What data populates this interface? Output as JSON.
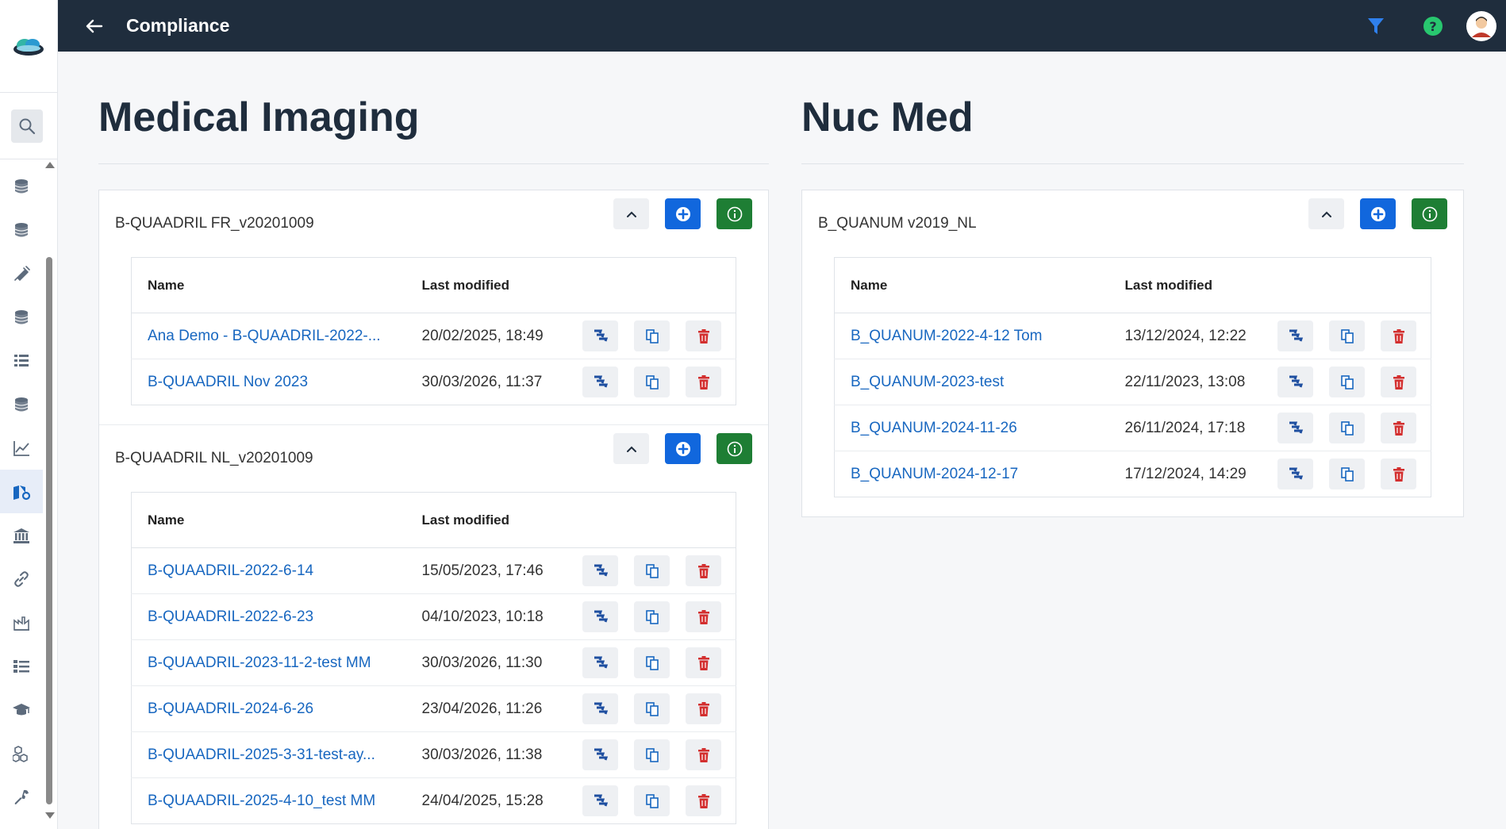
{
  "app": {
    "title": "Compliance"
  },
  "colors": {
    "topbar": "#1f2d3d",
    "link": "#1867c0",
    "add": "#1167dd",
    "info": "#1e7e34",
    "delete": "#d32f2f",
    "help": "#28c76f",
    "filter": "#2f80ed"
  },
  "sidebar": {
    "icons": [
      "database-icon",
      "database-icon",
      "syringe-icon",
      "database-icon",
      "list-icon",
      "database-icon",
      "chart-line-icon",
      "book-gear-icon",
      "bank-icon",
      "link-icon",
      "factory-chart-icon",
      "checklist-icon",
      "graduation-cap-icon",
      "cubes-icon",
      "wrench-icon"
    ],
    "active_index": 7
  },
  "columns": [
    {
      "title": "Medical Imaging",
      "sections": [
        {
          "title": "B-QUAADRIL FR_v20201009",
          "headers": {
            "name": "Name",
            "modified": "Last modified"
          },
          "rows": [
            {
              "name": "Ana Demo - B-QUAADRIL-2022-...",
              "modified": "20/02/2025, 18:49"
            },
            {
              "name": "B-QUAADRIL Nov 2023",
              "modified": "30/03/2026, 11:37"
            }
          ]
        },
        {
          "title": "B-QUAADRIL NL_v20201009",
          "headers": {
            "name": "Name",
            "modified": "Last modified"
          },
          "rows": [
            {
              "name": "B-QUAADRIL-2022-6-14",
              "modified": "15/05/2023, 17:46"
            },
            {
              "name": "B-QUAADRIL-2022-6-23",
              "modified": "04/10/2023, 10:18"
            },
            {
              "name": "B-QUAADRIL-2023-11-2-test MM",
              "modified": "30/03/2026, 11:30"
            },
            {
              "name": "B-QUAADRIL-2024-6-26",
              "modified": "23/04/2026, 11:26"
            },
            {
              "name": "B-QUAADRIL-2025-3-31-test-ay...",
              "modified": "30/03/2026, 11:38"
            },
            {
              "name": "B-QUAADRIL-2025-4-10_test MM",
              "modified": "24/04/2025, 15:28"
            }
          ]
        }
      ]
    },
    {
      "title": "Nuc Med",
      "sections": [
        {
          "title": "B_QUANUM v2019_NL",
          "headers": {
            "name": "Name",
            "modified": "Last modified"
          },
          "rows": [
            {
              "name": "B_QUANUM-2022-4-12 Tom",
              "modified": "13/12/2024, 12:22"
            },
            {
              "name": "B_QUANUM-2023-test",
              "modified": "22/11/2023, 13:08"
            },
            {
              "name": "B_QUANUM-2024-11-26",
              "modified": "26/11/2024, 17:18"
            },
            {
              "name": "B_QUANUM-2024-12-17",
              "modified": "17/12/2024, 14:29"
            }
          ]
        }
      ]
    }
  ]
}
